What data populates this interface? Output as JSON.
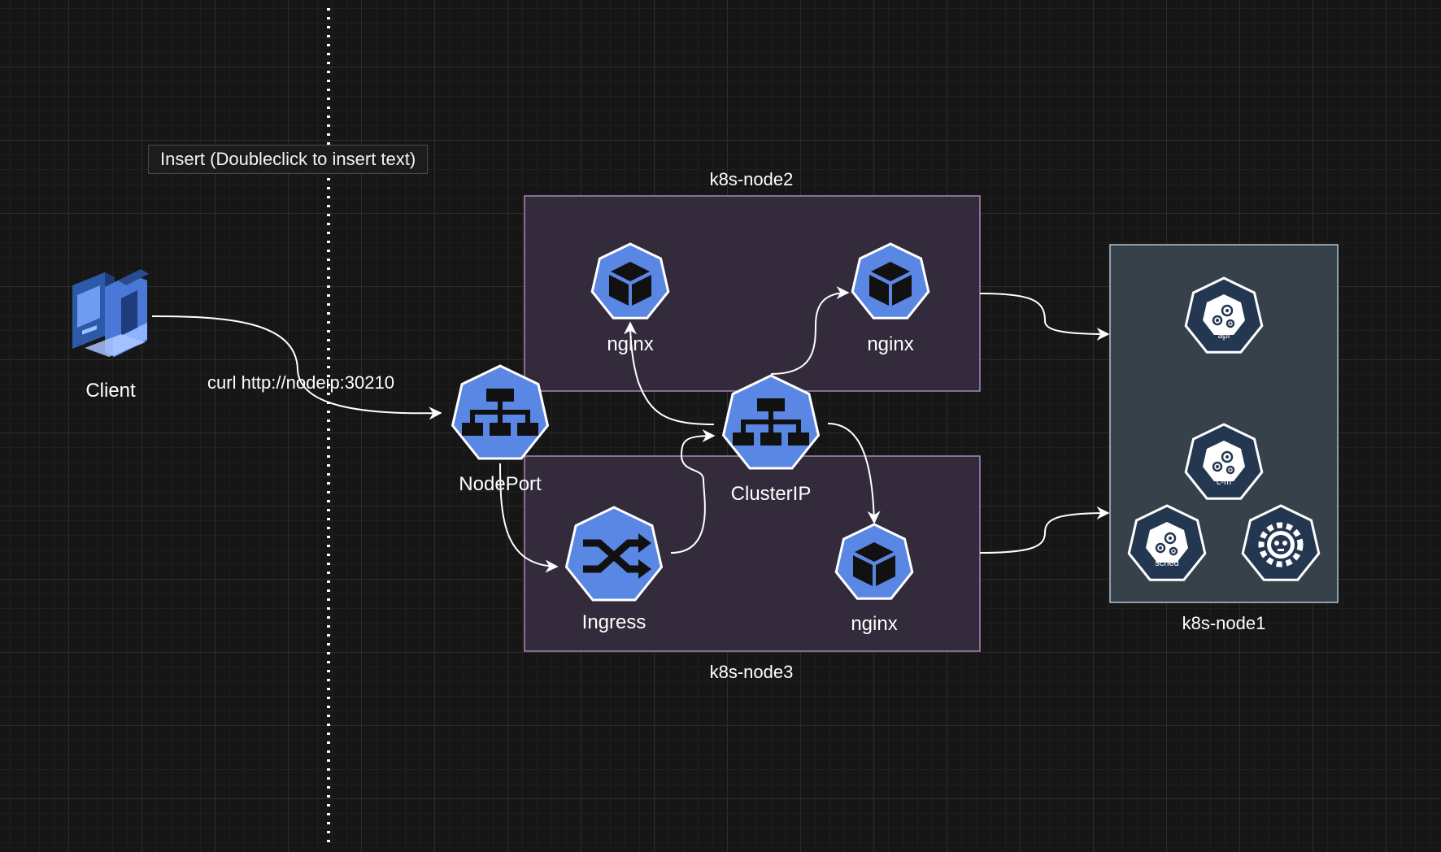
{
  "tooltip": {
    "text": "Insert (Doubleclick to insert text)"
  },
  "edge_labels": {
    "client_to_nodeport": "curl http://nodeip:30210"
  },
  "groups": {
    "node2": {
      "label": "k8s-node2",
      "fill": "#332a3b",
      "stroke": "#a489b8"
    },
    "node3": {
      "label": "k8s-node3",
      "fill": "#332a3b",
      "stroke": "#a489b8"
    },
    "node1": {
      "label": "k8s-node1",
      "fill": "#36414a",
      "stroke": "#b4c6d4"
    }
  },
  "nodes": {
    "client": {
      "label": "Client",
      "icon": "client-icon"
    },
    "nodeport": {
      "label": "NodePort",
      "icon": "service-icon"
    },
    "clusterip": {
      "label": "ClusterIP",
      "icon": "service-icon"
    },
    "ingress": {
      "label": "Ingress",
      "icon": "ingress-icon"
    },
    "nginx_a": {
      "label": "nginx",
      "icon": "pod-icon"
    },
    "nginx_b": {
      "label": "nginx",
      "icon": "pod-icon"
    },
    "nginx_c": {
      "label": "nginx",
      "icon": "pod-icon"
    },
    "api": {
      "label": "api",
      "icon": "api-server-icon"
    },
    "cm": {
      "label": "c-m",
      "icon": "controller-manager-icon"
    },
    "sched": {
      "label": "sched",
      "icon": "scheduler-icon"
    },
    "kubelet": {
      "label": "",
      "icon": "kubelet-icon"
    }
  },
  "colors": {
    "k8s_blue": "#5a87e4",
    "k8s_dark": "#243751",
    "edge": "#ffffff",
    "separator": "#ffffff"
  }
}
